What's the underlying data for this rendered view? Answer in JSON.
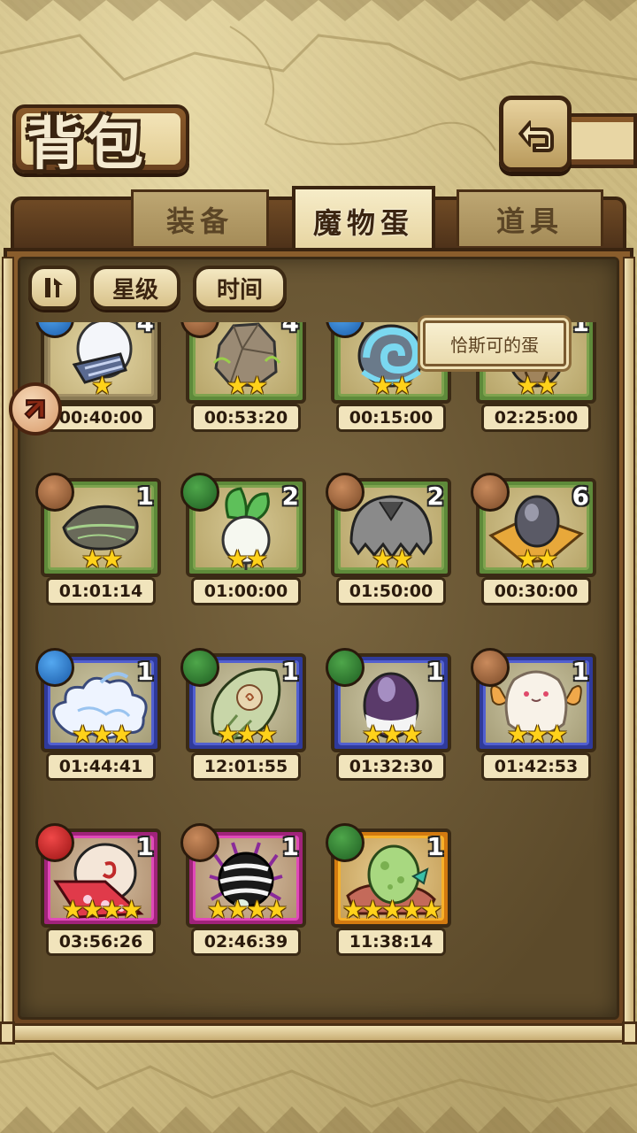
{
  "header": {
    "title": "背包"
  },
  "tabs": [
    {
      "label": "装备",
      "active": false
    },
    {
      "label": "魔物蛋",
      "active": true
    },
    {
      "label": "道具",
      "active": false
    }
  ],
  "sort": {
    "star_label": "星级",
    "time_label": "时间"
  },
  "tooltip": "恰斯可的蛋",
  "items": [
    {
      "element": "water",
      "count": "4",
      "stars": 1,
      "rarity": 1,
      "timer": "00:40:00",
      "egg": "white-feather-egg"
    },
    {
      "element": "earth",
      "count": "4",
      "stars": 2,
      "rarity": 2,
      "timer": "00:53:20",
      "egg": "stone-egg"
    },
    {
      "element": "water",
      "count": "",
      "stars": 2,
      "rarity": 2,
      "timer": "00:15:00",
      "egg": "spiral-shell-egg"
    },
    {
      "element": "",
      "count": "1",
      "stars": 2,
      "rarity": 2,
      "timer": "02:25:00",
      "egg": "brown-egg"
    },
    {
      "element": "earth",
      "count": "1",
      "stars": 2,
      "rarity": 2,
      "timer": "01:01:14",
      "egg": "leaf-egg"
    },
    {
      "element": "plant",
      "count": "2",
      "stars": 2,
      "rarity": 2,
      "timer": "01:00:00",
      "egg": "turnip-egg"
    },
    {
      "element": "earth",
      "count": "2",
      "stars": 2,
      "rarity": 2,
      "timer": "01:50:00",
      "egg": "grey-fur-egg"
    },
    {
      "element": "earth",
      "count": "6",
      "stars": 2,
      "rarity": 2,
      "timer": "00:30:00",
      "egg": "hat-egg"
    },
    {
      "element": "water",
      "count": "1",
      "stars": 3,
      "rarity": 3,
      "timer": "01:44:41",
      "egg": "cloud-egg"
    },
    {
      "element": "plant",
      "count": "1",
      "stars": 3,
      "rarity": 3,
      "timer": "12:01:55",
      "egg": "bulb-egg"
    },
    {
      "element": "plant",
      "count": "1",
      "stars": 3,
      "rarity": 3,
      "timer": "01:32:30",
      "egg": "purple-egg"
    },
    {
      "element": "earth",
      "count": "1",
      "stars": 3,
      "rarity": 3,
      "timer": "01:42:53",
      "egg": "fluffy-egg"
    },
    {
      "element": "fire",
      "count": "1",
      "stars": 4,
      "rarity": 4,
      "timer": "03:56:26",
      "egg": "kimono-egg"
    },
    {
      "element": "earth",
      "count": "1",
      "stars": 4,
      "rarity": 4,
      "timer": "02:46:39",
      "egg": "spider-egg"
    },
    {
      "element": "plant",
      "count": "1",
      "stars": 5,
      "rarity": 5,
      "timer": "11:38:14",
      "egg": "green-egg"
    }
  ],
  "colors": {
    "panel_brown": "#6e4621",
    "parchment": "#f1e4bc",
    "star_gold": "#ffd21a",
    "rarity_2": "#5e8a3a",
    "rarity_3": "#2f3a9a",
    "rarity_4": "#a0237a",
    "rarity_5": "#d27a10"
  }
}
